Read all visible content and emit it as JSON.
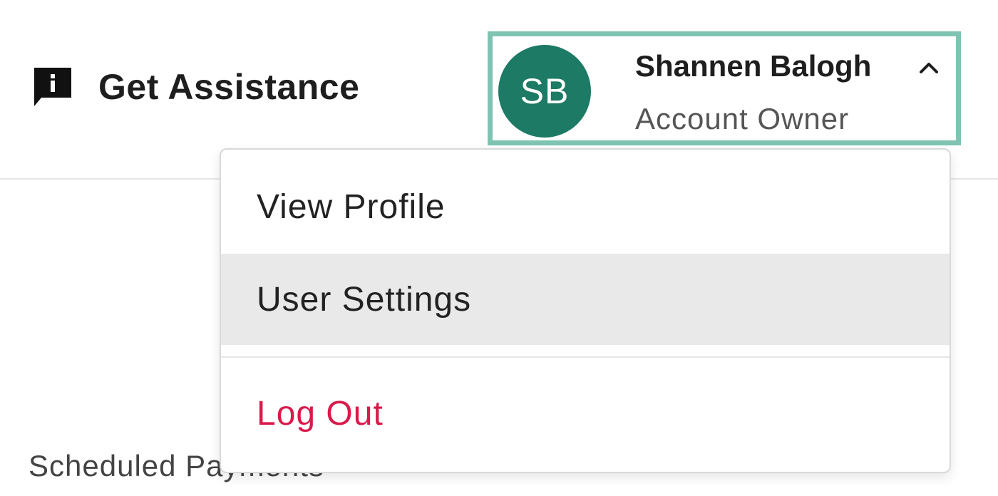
{
  "header": {
    "assist": {
      "label": "Get Assistance",
      "icon": "info-chat-icon"
    },
    "account": {
      "initials": "SB",
      "name": "Shannen Balogh",
      "role": "Account Owner",
      "expanded_icon": "chevron-up-icon",
      "avatar_color": "#1d7a64",
      "focus_color": "#7fc4b2"
    }
  },
  "account_menu": {
    "items": [
      {
        "label": "View Profile"
      },
      {
        "label": "User Settings"
      },
      {
        "label": "Log Out"
      }
    ],
    "logout_color": "#d91a4a",
    "hover_color": "#e9e9e9"
  },
  "background": {
    "section_label": "Scheduled Payments"
  }
}
